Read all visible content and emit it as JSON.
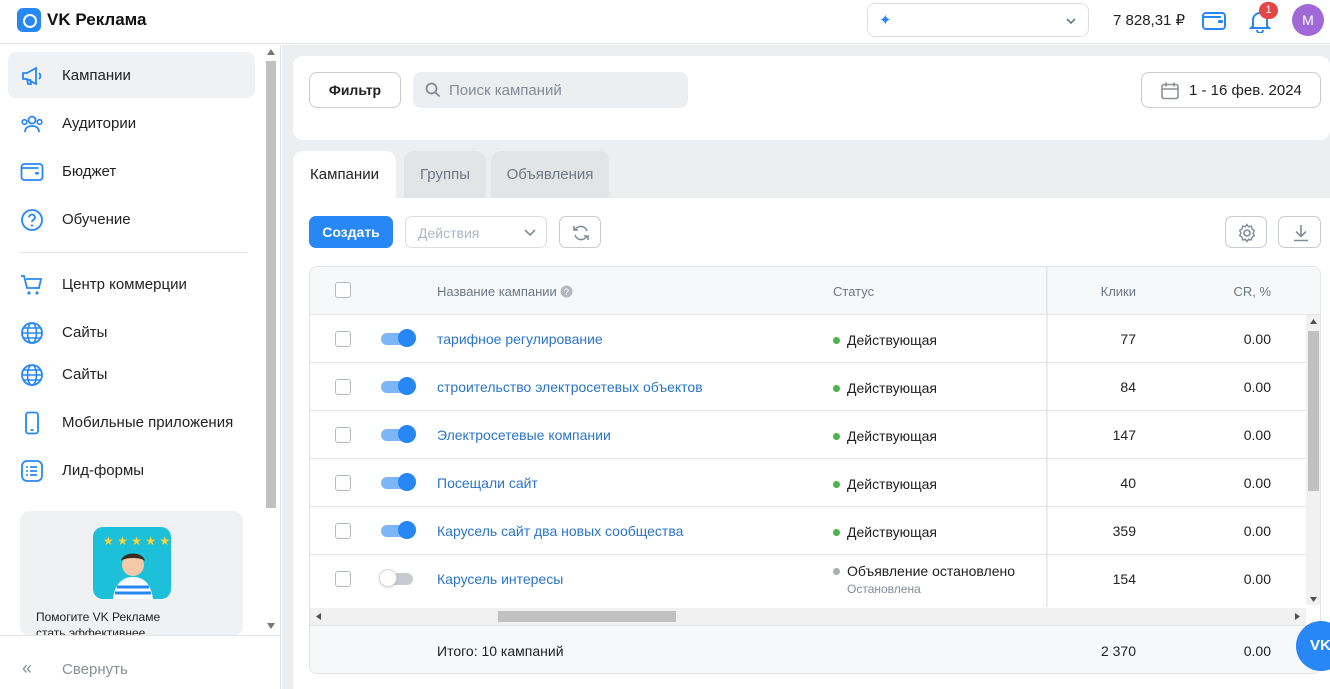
{
  "app": {
    "title": "VK Реклама"
  },
  "header": {
    "account_name": "",
    "balance": "7 828,31 ₽",
    "notifications_count": "1",
    "avatar_letter": "M"
  },
  "sidebar": {
    "items": [
      {
        "label": "Кампании",
        "icon": "megaphone-icon"
      },
      {
        "label": "Аудитории",
        "icon": "users-icon"
      },
      {
        "label": "Бюджет",
        "icon": "wallet-icon"
      },
      {
        "label": "Обучение",
        "icon": "question-icon"
      },
      {
        "label": "Центр коммерции",
        "icon": "cart-icon"
      },
      {
        "label": "Сайты",
        "icon": "globe-icon"
      },
      {
        "label": "Сайты",
        "icon": "globe-icon"
      },
      {
        "label": "Мобильные приложения",
        "icon": "phone-icon"
      },
      {
        "label": "Лид-формы",
        "icon": "list-icon"
      }
    ],
    "promo": {
      "line1": "Помогите VK Рекламе",
      "line2": "стать эффективнее"
    },
    "collapse_label": "Свернуть"
  },
  "filters": {
    "filter_label": "Фильтр",
    "search_placeholder": "Поиск кампаний",
    "date_range": "1 - 16 фев. 2024"
  },
  "tabs": [
    {
      "label": "Кампании"
    },
    {
      "label": "Группы"
    },
    {
      "label": "Объявления"
    }
  ],
  "toolbar": {
    "create_label": "Создать",
    "actions_placeholder": "Действия"
  },
  "table": {
    "headers": {
      "name": "Название кампании",
      "status": "Статус",
      "clicks": "Клики",
      "cr": "CR, %"
    },
    "rows": [
      {
        "name": "тарифное регулирование",
        "status": "Действующая",
        "substatus": "",
        "clicks": "77",
        "cr": "0.00",
        "enabled": true
      },
      {
        "name": "строительство электросетевых объектов",
        "status": "Действующая",
        "substatus": "",
        "clicks": "84",
        "cr": "0.00",
        "enabled": true
      },
      {
        "name": "Электросетевые компании",
        "status": "Действующая",
        "substatus": "",
        "clicks": "147",
        "cr": "0.00",
        "enabled": true
      },
      {
        "name": "Посещали сайт",
        "status": "Действующая",
        "substatus": "",
        "clicks": "40",
        "cr": "0.00",
        "enabled": true
      },
      {
        "name": "Карусель сайт два новых сообщества",
        "status": "Действующая",
        "substatus": "",
        "clicks": "359",
        "cr": "0.00",
        "enabled": true
      },
      {
        "name": "Карусель интересы",
        "status": "Объявление остановлено",
        "substatus": "Остановлена",
        "clicks": "154",
        "cr": "0.00",
        "enabled": false
      }
    ],
    "footer": {
      "total_label": "Итого: 10 кампаний",
      "clicks": "2 370",
      "cr": "0.00"
    }
  },
  "fab": {
    "label": "VK"
  },
  "colors": {
    "accent": "#2787f5",
    "active_status": "#4bb34b",
    "stopped_status": "#aaaeb3",
    "badge": "#e64646"
  }
}
